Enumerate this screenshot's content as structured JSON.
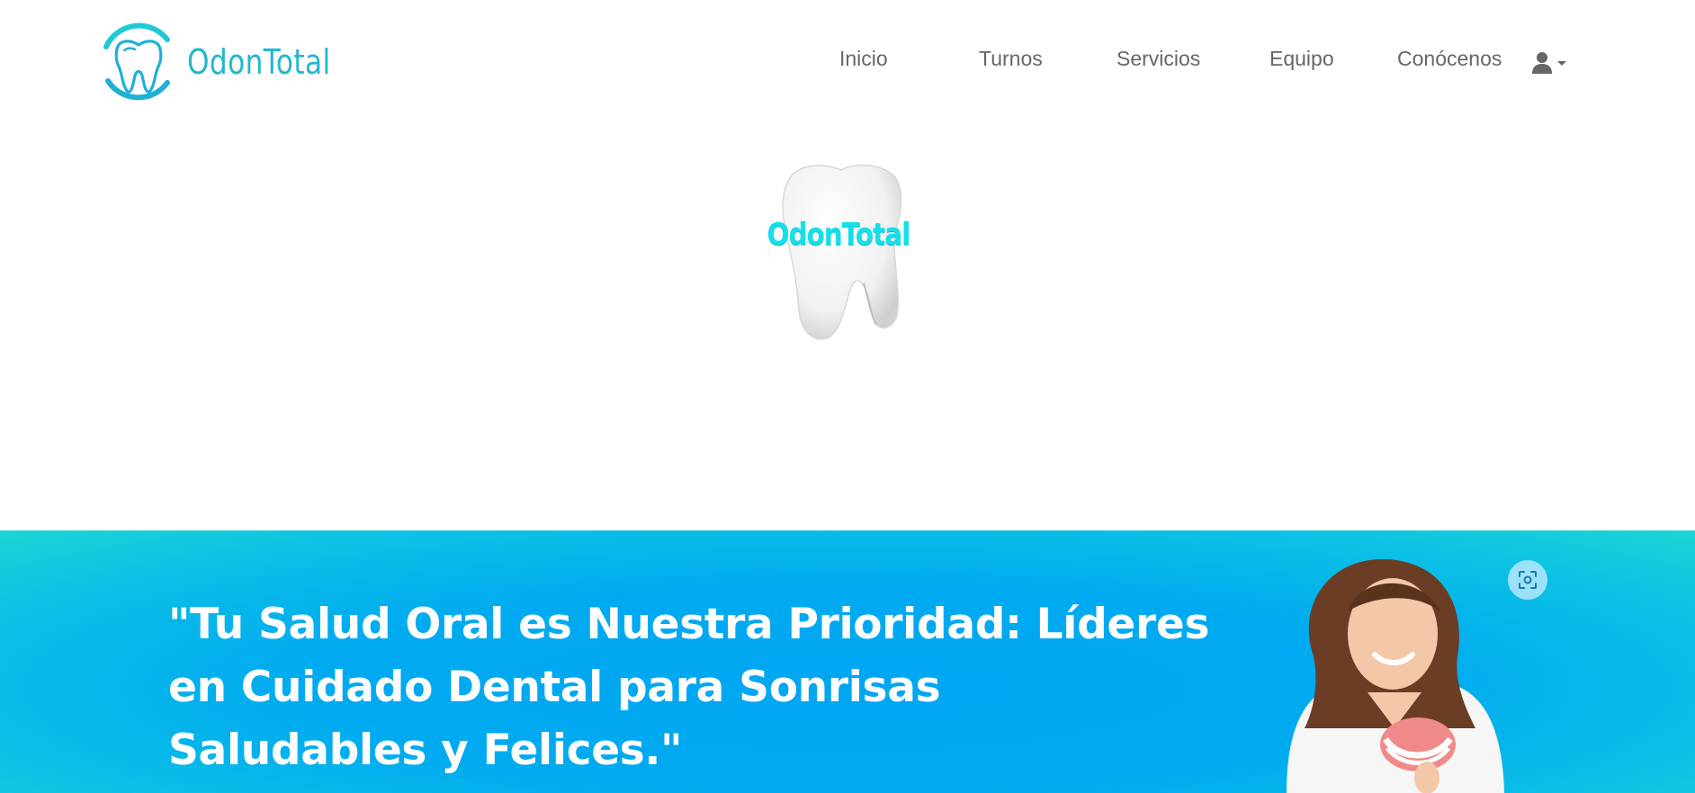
{
  "brand": {
    "name": "OdonTotal",
    "logo_icon": "tooth-logo-icon",
    "color": "#22b7cf"
  },
  "nav": {
    "items": [
      {
        "label": "Inicio"
      },
      {
        "label": "Turnos"
      },
      {
        "label": "Servicios"
      },
      {
        "label": "Equipo"
      },
      {
        "label": "Conócenos"
      }
    ],
    "user_menu_icon": "user-icon",
    "user_menu_caret": "caret-down-icon"
  },
  "hero": {
    "logo_text": "OdonTotal",
    "logo_color": "#13e0ea"
  },
  "banner": {
    "headline": "\"Tu Salud Oral es Nuestra Prioridad: Líderes en Cuidado Dental para Sonrisas Saludables y Felices.\"",
    "background_color": "#00a8f0",
    "image": "woman-holding-dental-model-photo",
    "scan_button_icon": "scan-icon"
  }
}
